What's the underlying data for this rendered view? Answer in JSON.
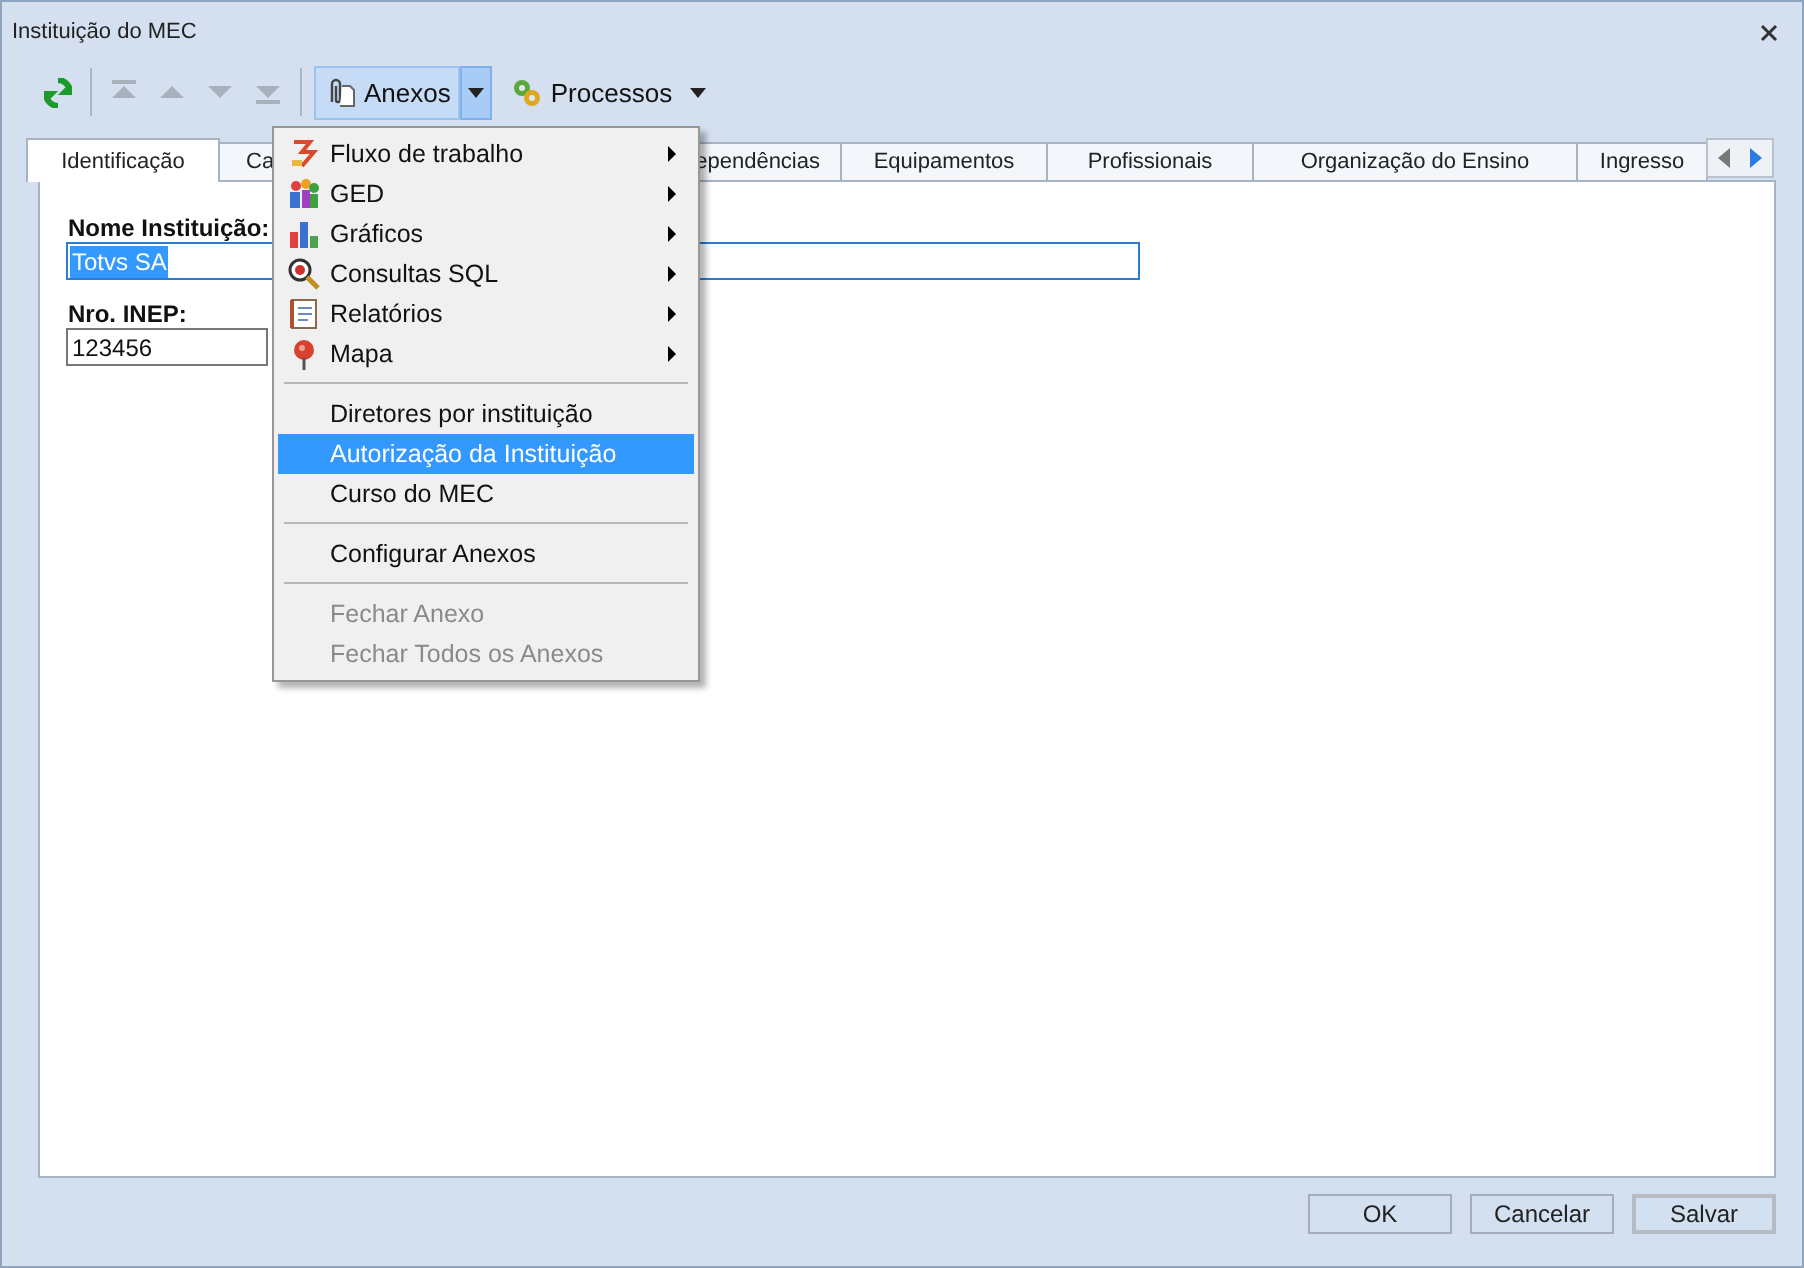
{
  "window": {
    "title": "Instituição do MEC"
  },
  "toolbar": {
    "nav_buttons": [
      {
        "kind": "first",
        "disabled": true
      },
      {
        "kind": "prev",
        "disabled": true
      },
      {
        "kind": "next",
        "disabled": true
      },
      {
        "kind": "last",
        "disabled": true
      }
    ],
    "menus": [
      {
        "label": "Anexos",
        "kind": "attach",
        "open": true
      },
      {
        "label": "Processos",
        "kind": "gears",
        "open": false
      }
    ]
  },
  "tabs": [
    {
      "label": "Identificação",
      "selected": true
    },
    {
      "label": "Ca",
      "selected": false
    },
    {
      "label": "ependências",
      "selected": false
    },
    {
      "label": "Equipamentos",
      "selected": false
    },
    {
      "label": "Profissionais",
      "selected": false
    },
    {
      "label": "Organização do Ensino",
      "selected": false
    },
    {
      "label": "Ingresso",
      "selected": false
    }
  ],
  "fields": [
    {
      "label": "Nome Instituição:",
      "value": "Totvs SA",
      "kind": "wide",
      "text_selected": true
    },
    {
      "label": "Nro. INEP:",
      "value": "123456",
      "kind": "short",
      "text_selected": false
    }
  ],
  "menu": [
    {
      "kind": "submenu",
      "label": "Fluxo de trabalho",
      "selected": false,
      "disabled": false
    },
    {
      "kind": "submenu",
      "label": "GED",
      "selected": false,
      "disabled": false
    },
    {
      "kind": "submenu",
      "label": "Gráficos",
      "selected": false,
      "disabled": false
    },
    {
      "kind": "submenu",
      "label": "Consultas SQL",
      "selected": false,
      "disabled": false
    },
    {
      "kind": "submenu",
      "label": "Relatórios",
      "selected": false,
      "disabled": false
    },
    {
      "kind": "submenu",
      "label": "Mapa",
      "selected": false,
      "disabled": false
    },
    {
      "kind": "separator"
    },
    {
      "kind": "item",
      "label": "Diretores por instituição",
      "selected": false,
      "disabled": false
    },
    {
      "kind": "item",
      "label": "Autorização da Instituição",
      "selected": true,
      "disabled": false
    },
    {
      "kind": "item",
      "label": "Curso do MEC",
      "selected": false,
      "disabled": false
    },
    {
      "kind": "separator"
    },
    {
      "kind": "item",
      "label": "Configurar Anexos",
      "selected": false,
      "disabled": false
    },
    {
      "kind": "separator"
    },
    {
      "kind": "item",
      "label": "Fechar Anexo",
      "selected": false,
      "disabled": true
    },
    {
      "kind": "item",
      "label": "Fechar Todos os Anexos",
      "selected": false,
      "disabled": true
    }
  ],
  "buttons": [
    {
      "label": "OK",
      "default": false
    },
    {
      "label": "Cancelar",
      "default": false
    },
    {
      "label": "Salvar",
      "default": true
    }
  ]
}
